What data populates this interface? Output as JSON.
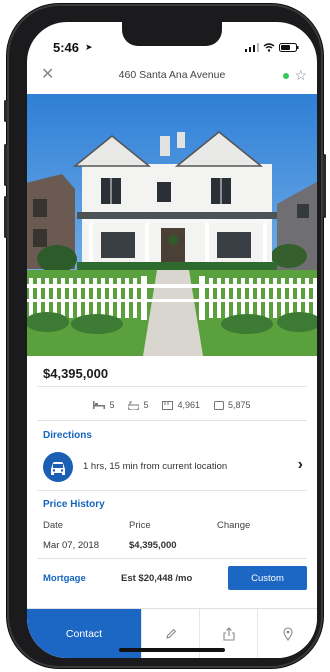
{
  "status": {
    "time": "5:46"
  },
  "navbar": {
    "title": "460 Santa Ana Avenue",
    "close_icon": "close-icon",
    "favorite_icon": "star-outline-icon",
    "status_color": "#34c759"
  },
  "listing": {
    "price": "$4,395,000",
    "beds": "5",
    "baths": "5",
    "sqft": "4,961",
    "lot": "5,875"
  },
  "directions": {
    "title": "Directions",
    "text": "1 hrs, 15 min from current location",
    "icon": "car-icon"
  },
  "price_history": {
    "title": "Price History",
    "columns": [
      "Date",
      "Price",
      "Change"
    ],
    "rows": [
      {
        "date": "Mar 07, 2018",
        "price": "$4,395,000",
        "change": ""
      }
    ]
  },
  "mortgage": {
    "title": "Mortgage",
    "estimate": "Est  $20,448 /mo",
    "custom_label": "Custom"
  },
  "bottombar": {
    "contact_label": "Contact",
    "icons": [
      "pencil-icon",
      "share-icon",
      "location-pin-icon"
    ]
  },
  "colors": {
    "accent": "#1c66c4",
    "section_title": "#1565c0"
  }
}
